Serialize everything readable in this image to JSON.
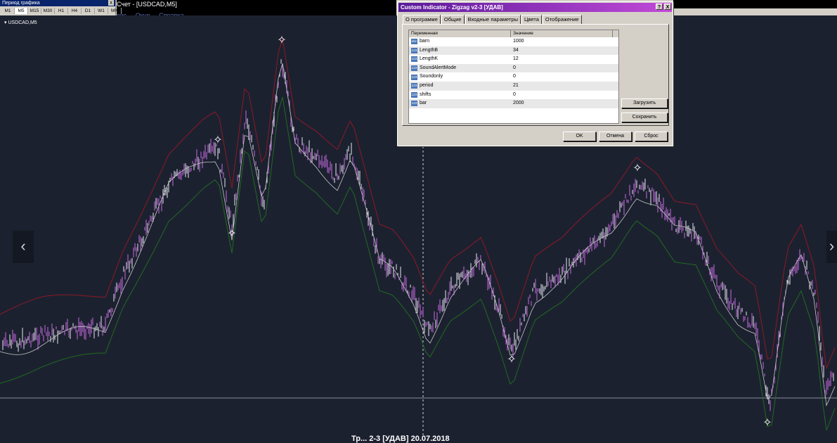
{
  "window": {
    "title": "Счет - [USDCAD,M5]",
    "menu": [
      "вис",
      "Окно",
      "Справка"
    ]
  },
  "period_toolbar": {
    "title": "Период графика",
    "close": "x",
    "periods": [
      "M1",
      "M5",
      "M15",
      "M30",
      "H1",
      "H4",
      "D1",
      "W1",
      "MN"
    ],
    "active": "M5"
  },
  "chart": {
    "symbol_label": "USDCAD,M5",
    "footer_text": "Тр...  2-3 [УДАВ] 20.07.2018",
    "background": "#1c2130",
    "candle_color": "#c66be0",
    "upper_band_color": "#8b1a24",
    "lower_band_color": "#1f6b1f",
    "mid_line_color": "#c8c8c8",
    "prev_arrow": "‹",
    "next_arrow": "›"
  },
  "dialog": {
    "title": "Custom Indicator - Zigzag v2-3 [УДАВ]",
    "help_btn": "?",
    "close_btn": "X",
    "tabs": [
      "О программе",
      "Общие",
      "Входные параметры",
      "Цвета",
      "Отображение"
    ],
    "active_tab": "Входные параметры",
    "columns": [
      "Переменная",
      "Значение"
    ],
    "params": [
      {
        "icon": "abc",
        "name": "barn",
        "value": "1000"
      },
      {
        "icon": "123",
        "name": "LengthB",
        "value": "34"
      },
      {
        "icon": "123",
        "name": "LengthK",
        "value": "12"
      },
      {
        "icon": "123",
        "name": "SoundAlertMode",
        "value": "0"
      },
      {
        "icon": "123",
        "name": "Soundonly",
        "value": "0"
      },
      {
        "icon": "123",
        "name": "period",
        "value": "21"
      },
      {
        "icon": "123",
        "name": "shifts",
        "value": "0"
      },
      {
        "icon": "123",
        "name": "bar",
        "value": "2000"
      }
    ],
    "load_btn": "Загрузить",
    "save_btn": "Сохранить",
    "ok_btn": "OK",
    "cancel_btn": "Отмена",
    "reset_btn": "Сброс"
  }
}
